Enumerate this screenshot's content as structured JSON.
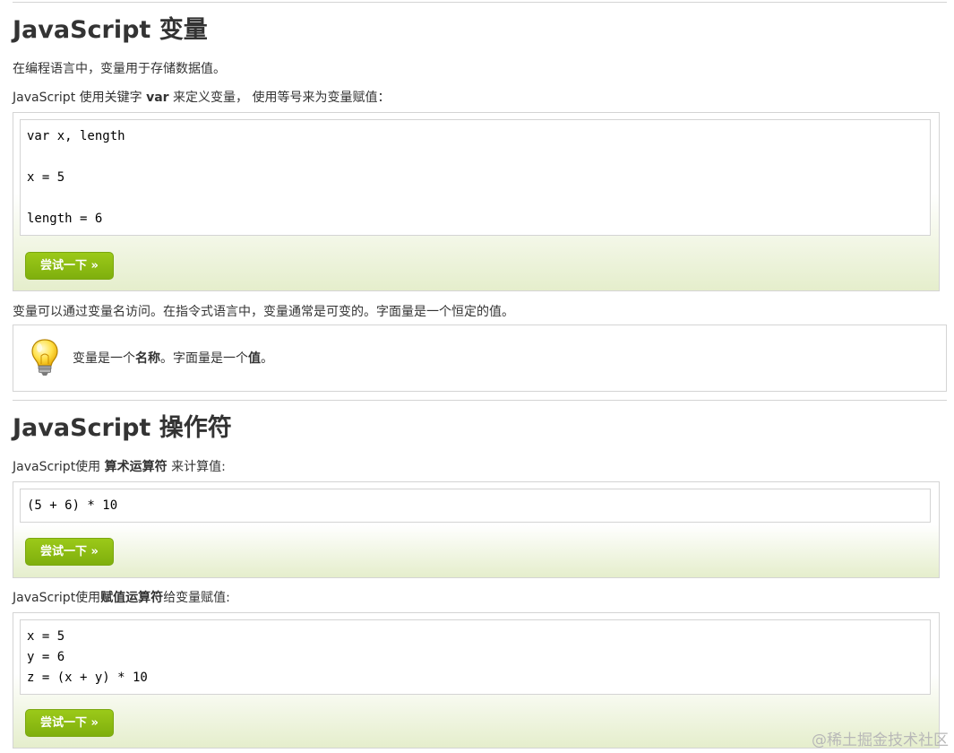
{
  "variables": {
    "heading": "JavaScript 变量",
    "intro": "在编程语言中，变量用于存储数据值。",
    "define_pre": "JavaScript 使用关键字 ",
    "define_keyword": "var",
    "define_post": " 来定义变量， 使用等号来为变量赋值：",
    "example_lines": [
      "var x, length",
      "",
      "x = 5",
      "",
      "length = 6"
    ],
    "try_button": "尝试一下 »",
    "access_text": "变量可以通过变量名访问。在指令式语言中，变量通常是可变的。字面量是一个恒定的值。",
    "tip_pre": "变量是一个",
    "tip_bold1": "名称",
    "tip_mid": "。字面量是一个",
    "tip_bold2": "值",
    "tip_post": "。"
  },
  "operators": {
    "heading": "JavaScript 操作符",
    "arith_pre": "JavaScript使用 ",
    "arith_bold": "算术运算符",
    "arith_post": " 来计算值:",
    "arith_example_lines": [
      "(5 + 6) * 10"
    ],
    "try_button_1": "尝试一下 »",
    "assign_pre": "JavaScript使用",
    "assign_bold": "赋值运算符",
    "assign_post": "给变量赋值:",
    "assign_example_lines": [
      "x = 5",
      "y = 6",
      "z = (x + y) * 10"
    ],
    "try_button_2": "尝试一下 »"
  },
  "watermark": "@稀土掘金技术社区",
  "icons": {
    "tip": "lightbulb-icon"
  },
  "colors": {
    "button_green": "#8ab913",
    "example_gradient_bottom": "#e5eecc",
    "border": "#d4d4d4"
  }
}
